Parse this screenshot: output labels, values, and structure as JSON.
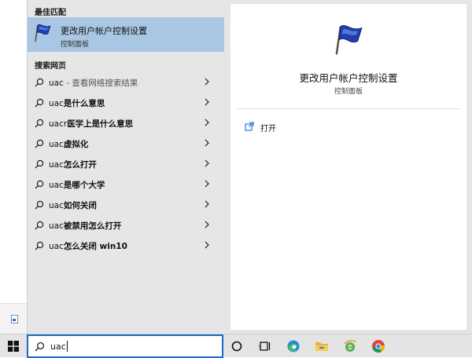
{
  "best_match": {
    "header": "最佳匹配",
    "title": "更改用户帐户控制设置",
    "subtitle": "控制面板"
  },
  "web_search": {
    "header": "搜索网页",
    "items": [
      {
        "query": "uac",
        "suffix": " - 查看网络搜索结果"
      },
      {
        "query": "uac",
        "suffix": "是什么意思"
      },
      {
        "query": "uacr",
        "suffix": "医学上是什么意思"
      },
      {
        "query": "uac",
        "suffix": "虚拟化"
      },
      {
        "query": "uac",
        "suffix": "怎么打开"
      },
      {
        "query": "uac",
        "suffix": "是哪个大学"
      },
      {
        "query": "uac",
        "suffix": "如何关闭"
      },
      {
        "query": "uac",
        "suffix": "被禁用怎么打开"
      },
      {
        "query": "uac",
        "suffix": "怎么关闭 win10"
      }
    ]
  },
  "detail": {
    "title": "更改用户帐户控制设置",
    "subtitle": "控制面板",
    "actions": [
      {
        "label": "打开",
        "icon": "open-icon"
      }
    ]
  },
  "taskbar": {
    "search_value": "uac",
    "icons": [
      "windows-start-icon",
      "cortana-icon",
      "task-view-icon",
      "edge-icon",
      "file-explorer-icon",
      "ie-icon",
      "chrome-icon"
    ]
  },
  "colors": {
    "accent": "#1b6ac9",
    "selected_bg": "#a9c6e2",
    "menu_bg": "#e6e6e6"
  }
}
